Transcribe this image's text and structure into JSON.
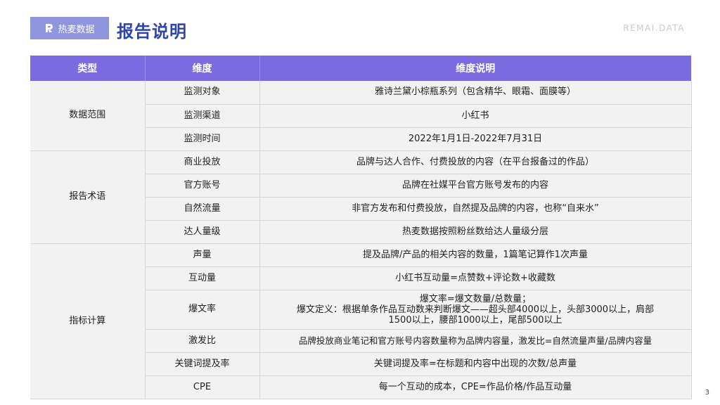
{
  "header": {
    "logo_text": "热麦数据",
    "title": "报告说明",
    "brand": "REMAI.DATA",
    "page_number": "3"
  },
  "table": {
    "headers": [
      "类型",
      "维度",
      "维度说明"
    ],
    "groups": [
      {
        "type": "数据范围",
        "rows": [
          {
            "dim": "监测对象",
            "desc": "雅诗兰黛小棕瓶系列（包含精华、眼霜、面膜等）"
          },
          {
            "dim": "监测渠道",
            "desc": "小红书"
          },
          {
            "dim": "监测时间",
            "desc": "2022年1月1日-2022年7月31日"
          }
        ]
      },
      {
        "type": "报告术语",
        "rows": [
          {
            "dim": "商业投放",
            "desc": "品牌与达人合作、付费投放的内容（在平台报备过的作品）"
          },
          {
            "dim": "官方账号",
            "desc": "品牌在社媒平台官方账号发布的内容"
          },
          {
            "dim": "自然流量",
            "desc": "非官方发布和付费投放，自然提及品牌的内容，也称“自来水”"
          },
          {
            "dim": "达人量级",
            "desc": "热麦数据按照粉丝数给达人量级分层"
          }
        ]
      },
      {
        "type": "指标计算",
        "rows": [
          {
            "dim": "声量",
            "desc": "提及品牌/产品的相关内容的数量，1篇笔记算作1次声量"
          },
          {
            "dim": "互动量",
            "desc": "小红书互动量=点赞数+评论数+收藏数"
          },
          {
            "dim": "爆文率",
            "desc_lines": [
              "爆文率=爆文数量/总数量；",
              "爆文定义：根据单条作品互动数来判断爆文——超头部4000以上，头部3000以上，肩部",
              "1500以上，腰部1000以上，尾部500以上"
            ]
          },
          {
            "dim": "激发比",
            "desc": "品牌投放商业笔记和官方账号内容数量称为品牌内容量，激发比=自然流量声量/品牌内容量"
          },
          {
            "dim": "关键词提及率",
            "desc": "关键词提及率=在标题和内容中出现的次数/总声量"
          },
          {
            "dim": "CPE",
            "desc": "每一个互动的成本，CPE=作品价格/作品互动量"
          }
        ]
      }
    ]
  }
}
